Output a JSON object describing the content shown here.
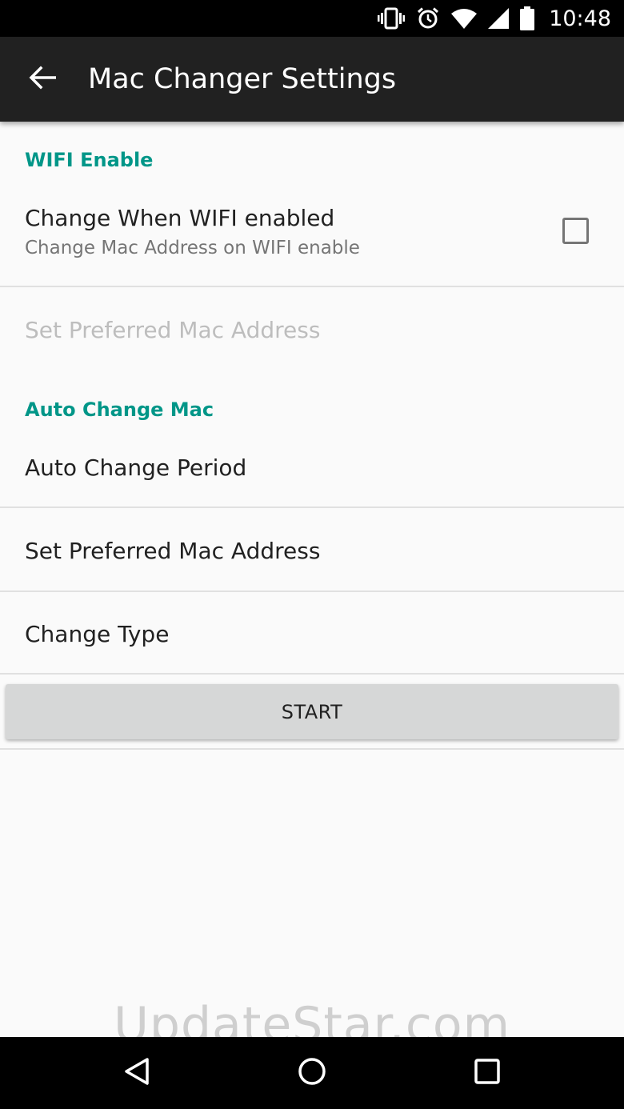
{
  "status_bar": {
    "time": "10:48",
    "icons": [
      "vibrate-icon",
      "alarm-icon",
      "wifi-icon",
      "signal-icon",
      "battery-icon"
    ]
  },
  "app_bar": {
    "title": "Mac Changer Settings",
    "back_icon": "arrow-back-icon"
  },
  "sections": {
    "wifi": {
      "header": "WIFI Enable",
      "change_when_wifi": {
        "title": "Change When WIFI enabled",
        "summary": "Change Mac Address on WIFI enable",
        "checked": false
      },
      "preferred_mac_disabled": "Set Preferred Mac Address"
    },
    "auto": {
      "header": "Auto Change Mac",
      "period": "Auto Change Period",
      "preferred_mac": "Set Preferred Mac Address",
      "change_type": "Change Type"
    }
  },
  "start_button": "START",
  "watermark": "UpdateStar.com",
  "nav_bar": {
    "back_icon": "nav-back-icon",
    "home_icon": "nav-home-icon",
    "recents_icon": "nav-recents-icon"
  },
  "colors": {
    "accent": "#009688",
    "app_bar": "#212121",
    "background": "#fafafa"
  }
}
